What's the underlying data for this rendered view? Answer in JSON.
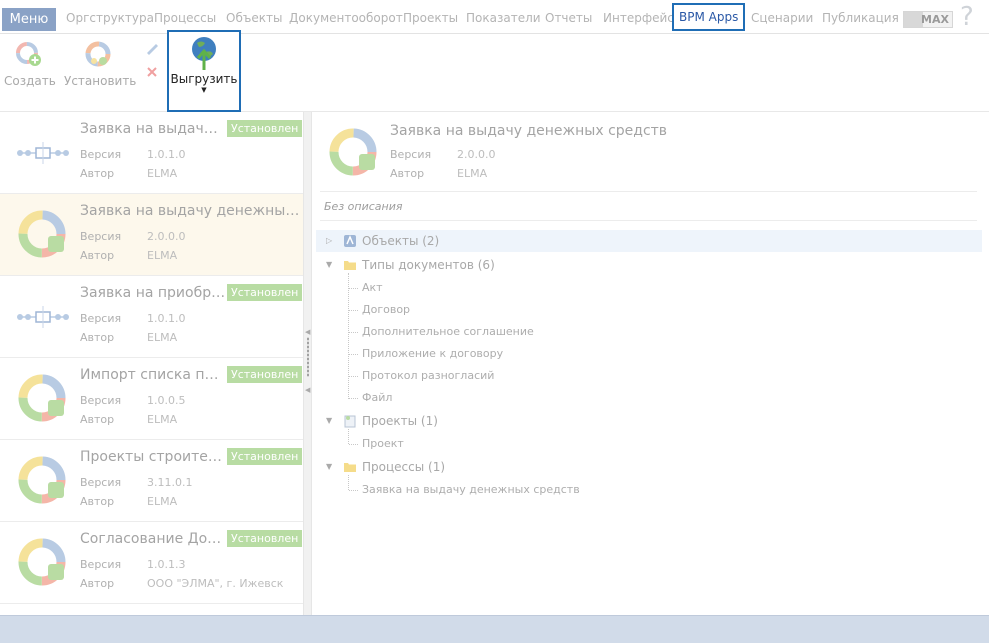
{
  "menubar": {
    "menu_label": "Меню",
    "items": [
      "Оргструктура",
      "Процессы",
      "Объекты",
      "Документооборот",
      "Проекты",
      "Показатели",
      "Отчеты",
      "Интерфейс",
      "BPM Apps",
      "Сценарии",
      "Публикация"
    ],
    "active_item": "BPM Apps",
    "max_label": "MAX",
    "help_glyph": "?"
  },
  "toolbar": {
    "create_label": "Создать",
    "install_label": "Установить",
    "upload_label": "Выгрузить"
  },
  "apps": [
    {
      "title": "Заявка на выдачу денежных средств",
      "version_label": "Версия",
      "version": "1.0.1.0",
      "author_label": "Автор",
      "author": "ELMA",
      "badge": "Установлен",
      "icon": "process-diagram-icon"
    },
    {
      "title": "Заявка на выдачу денежных средств",
      "version_label": "Версия",
      "version": "2.0.0.0",
      "author_label": "Автор",
      "author": "ELMA",
      "badge": "",
      "icon": "bpm-app-ring-icon"
    },
    {
      "title": "Заявка на приобретение",
      "version_label": "Версия",
      "version": "1.0.1.0",
      "author_label": "Автор",
      "author": "ELMA",
      "badge": "Установлен",
      "icon": "process-diagram-icon"
    },
    {
      "title": "Импорт списка пользователей",
      "version_label": "Версия",
      "version": "1.0.0.5",
      "author_label": "Автор",
      "author": "ELMA",
      "badge": "Установлен",
      "icon": "bpm-app-ring-icon"
    },
    {
      "title": "Проекты строительства",
      "version_label": "Версия",
      "version": "3.11.0.1",
      "author_label": "Автор",
      "author": "ELMA",
      "badge": "Установлен",
      "icon": "bpm-app-ring-icon"
    },
    {
      "title": "Согласование Договоров",
      "version_label": "Версия",
      "version": "1.0.1.3",
      "author_label": "Автор",
      "author": "ООО \"ЭЛМА\", г. Ижевск",
      "badge": "Установлен",
      "icon": "bpm-app-ring-icon"
    }
  ],
  "selected_index": 1,
  "detail": {
    "title": "Заявка на выдачу денежных средств",
    "version_label": "Версия",
    "version": "2.0.0.0",
    "author_label": "Автор",
    "author": "ELMA",
    "description": "Без описания",
    "tree": [
      {
        "label": "Объекты (2)",
        "expanded": false,
        "icon": "objects-icon",
        "children": []
      },
      {
        "label": "Типы документов (6)",
        "expanded": true,
        "icon": "folder-icon",
        "children": [
          "Акт",
          "Договор",
          "Дополнительное соглашение",
          "Приложение к договору",
          "Протокол разногласий",
          "Файл"
        ]
      },
      {
        "label": "Проекты (1)",
        "expanded": true,
        "icon": "projects-icon",
        "children": [
          "Проект"
        ]
      },
      {
        "label": "Процессы (1)",
        "expanded": true,
        "icon": "folder-icon",
        "children": [
          "Заявка на выдачу денежных средств"
        ]
      }
    ]
  },
  "colors": {
    "accent": "#1f6db5",
    "menu_button": "#8aa2c6",
    "badge": "#b8dca3",
    "selected_row": "#fdf8ec",
    "statusbar": "#d1dbe9"
  }
}
